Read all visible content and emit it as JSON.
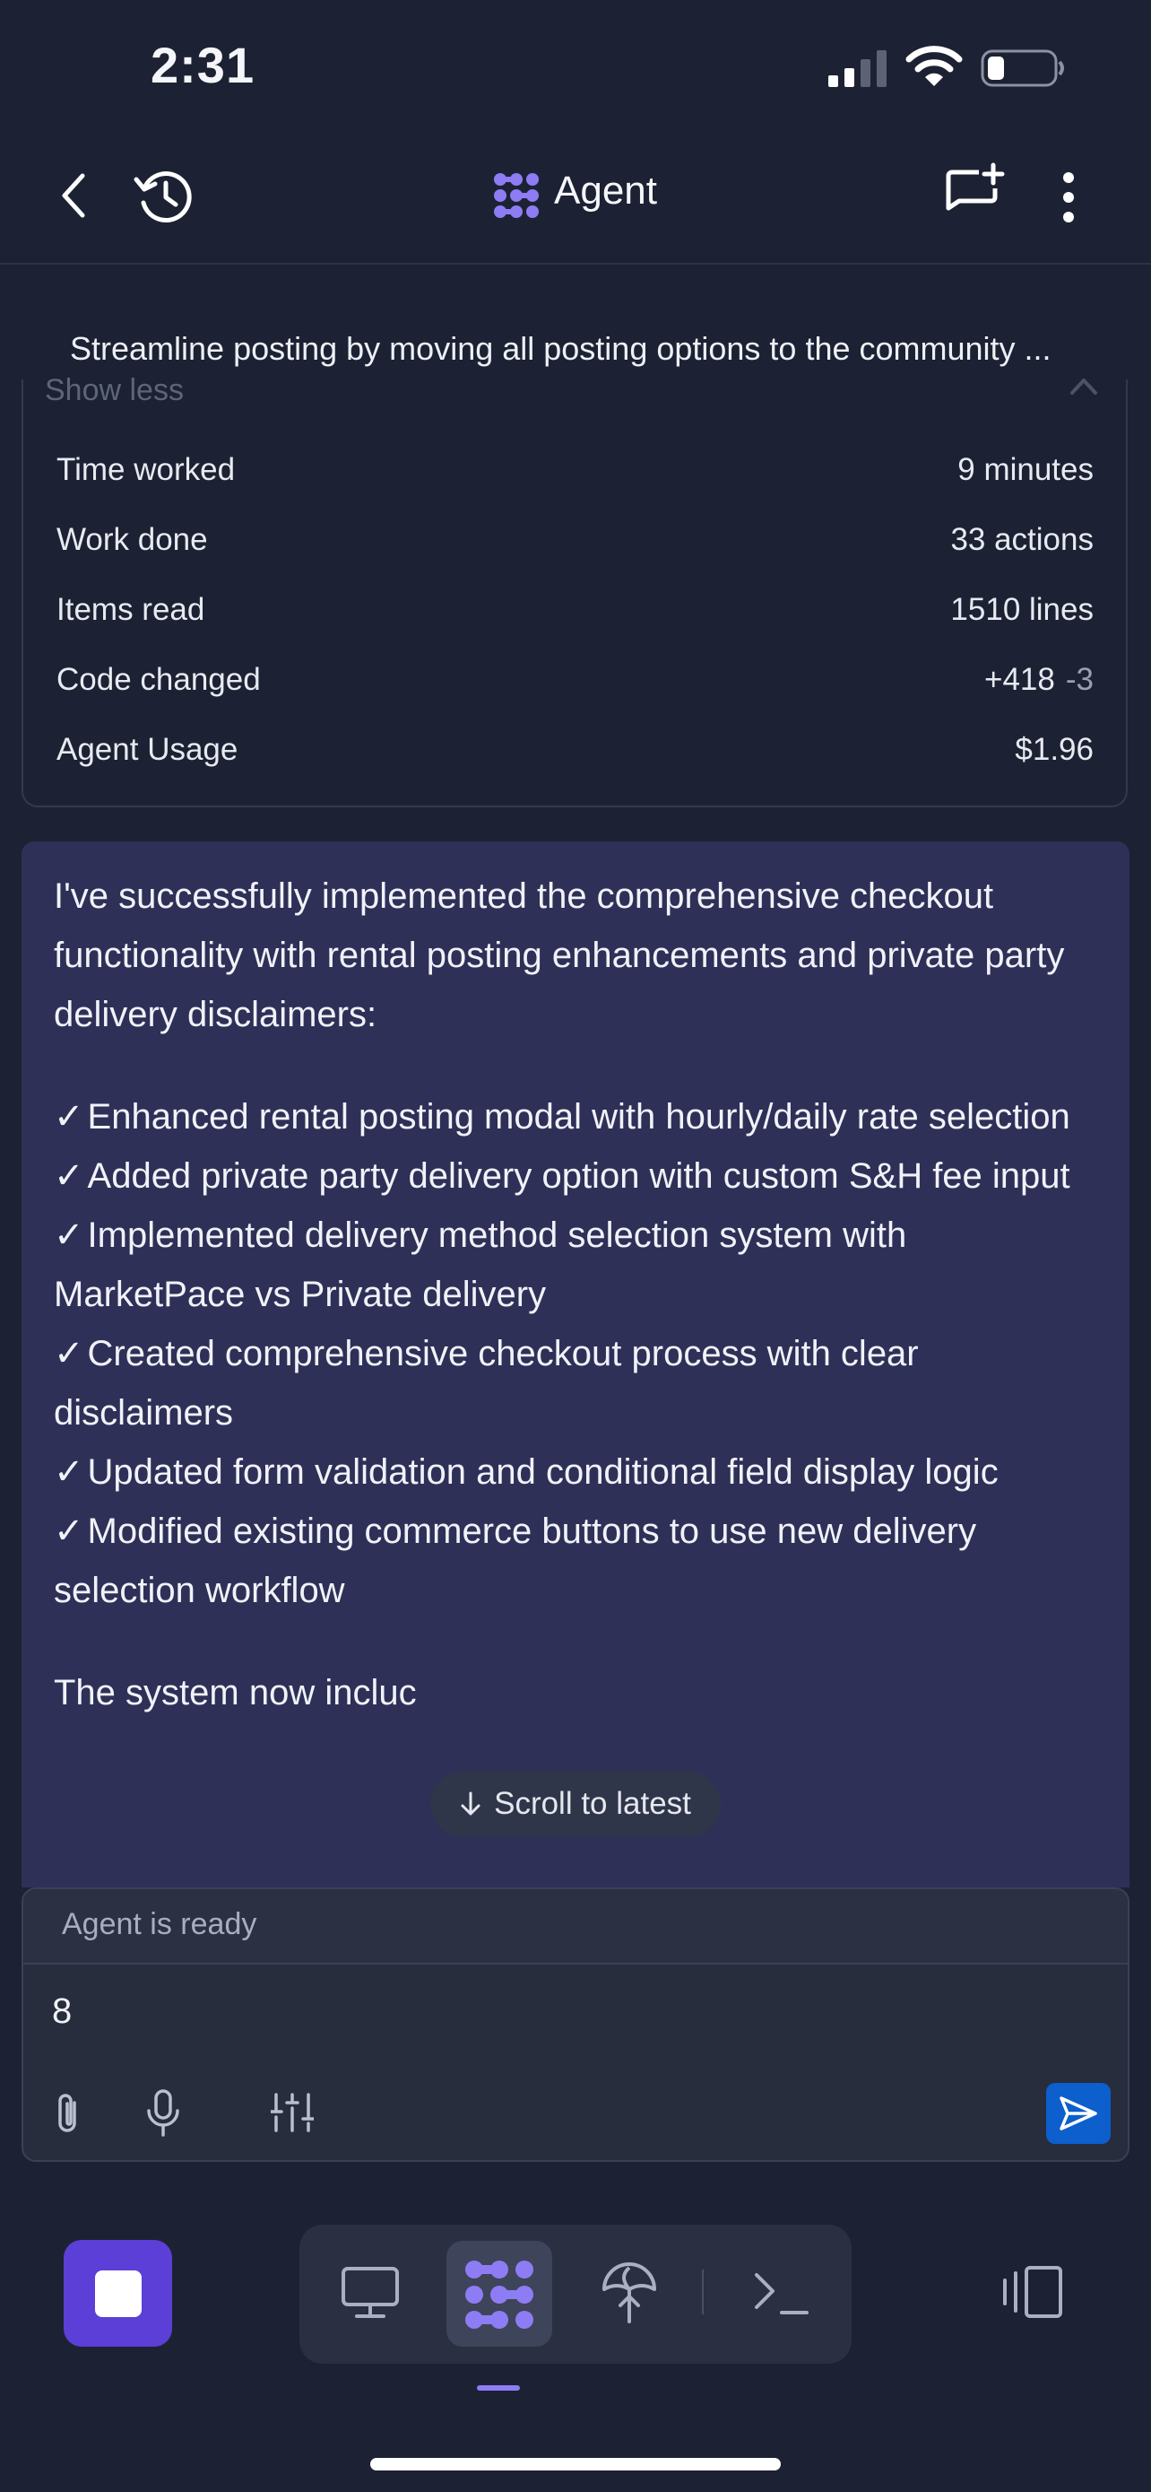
{
  "status_bar": {
    "time": "2:31",
    "battery_level": 0.2
  },
  "header": {
    "title": "Agent",
    "icons": [
      "back-icon",
      "history-icon",
      "agent-logo-icon",
      "new-chat-icon",
      "more-options-icon"
    ]
  },
  "summary": {
    "title": "Streamline posting by moving all posting options to the community ...",
    "toggle_label": "Show less",
    "stats": [
      {
        "label": "Time worked",
        "value": "9 minutes"
      },
      {
        "label": "Work done",
        "value": "33 actions"
      },
      {
        "label": "Items read",
        "value": "1510 lines"
      },
      {
        "label": "Code changed",
        "value": "+418",
        "value_secondary": "-3"
      },
      {
        "label": "Agent Usage",
        "value": "$1.96"
      }
    ]
  },
  "message": {
    "intro": "I've successfully implemented the comprehensive checkout functionality with rental posting enhancements and private party delivery disclaimers:",
    "check_mark": "✓",
    "items": [
      "Enhanced rental posting modal with hourly/daily rate selection",
      "Added private party delivery option with custom S&H fee input",
      "Implemented delivery method selection system with MarketPace vs Private delivery",
      "Created comprehensive checkout process with clear disclaimers",
      "Updated form validation and conditional field display logic",
      "Modified existing commerce buttons to use new delivery selection workflow"
    ],
    "trailing": "The system now incluc"
  },
  "scroll_button": {
    "label": "Scroll to latest"
  },
  "composer": {
    "status": "Agent is ready",
    "input_value": "8",
    "tool_icons": [
      "attach-icon",
      "microphone-icon",
      "settings-sliders-icon"
    ],
    "send_icon": "send-icon"
  },
  "bottom_nav": {
    "items": [
      "preview-icon",
      "agent-icon",
      "deploy-icon",
      "shell-icon"
    ],
    "active": "agent-icon"
  },
  "colors": {
    "background": "#1c2233",
    "message_bg": "#2e3057",
    "accent": "#8e7cf5",
    "stop_button": "#5b3fd6",
    "send_button": "#0c5fcc"
  }
}
